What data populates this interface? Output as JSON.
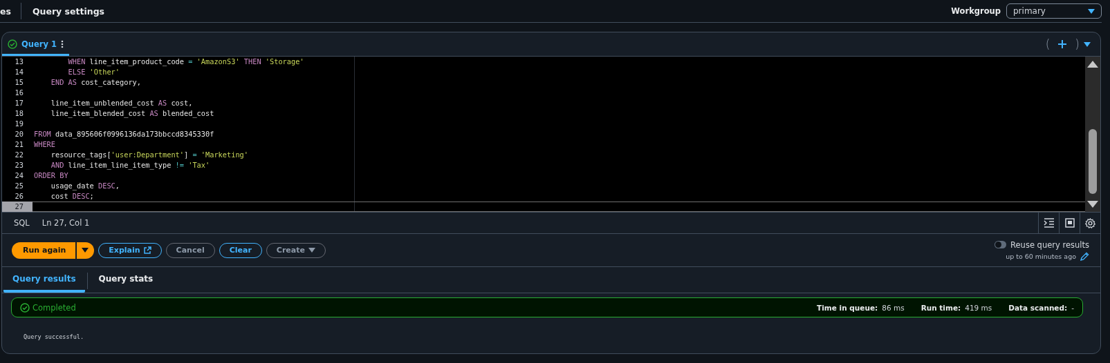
{
  "top_bar": {
    "tabs": [
      {
        "label": "es",
        "selected": false
      },
      {
        "label": "Query settings",
        "selected": false
      }
    ],
    "workgroup": {
      "label": "Workgroup",
      "value": "primary"
    }
  },
  "editor": {
    "tabs": [
      {
        "label": "Query 1",
        "selected": true,
        "succeeded": true
      }
    ],
    "new_tab": {
      "open": "(",
      "close": ")"
    },
    "lines": [
      {
        "number": "13",
        "selected": false,
        "tokens": [
          {
            "text": "        WHEN",
            "kind": "keyword"
          },
          {
            "text": " line_item_product_code ",
            "kind": "plain"
          },
          {
            "text": "=",
            "kind": "operator"
          },
          {
            "text": " 'AmazonS3'",
            "kind": "string"
          },
          {
            "text": " THEN",
            "kind": "keyword"
          },
          {
            "text": " 'Storage'",
            "kind": "string"
          }
        ]
      },
      {
        "number": "14",
        "selected": false,
        "tokens": [
          {
            "text": "        ELSE",
            "kind": "keyword"
          },
          {
            "text": " 'Other'",
            "kind": "string"
          }
        ]
      },
      {
        "number": "15",
        "selected": false,
        "tokens": [
          {
            "text": "    END",
            "kind": "keyword"
          },
          {
            "text": " AS",
            "kind": "keyword"
          },
          {
            "text": " cost_category,",
            "kind": "plain"
          }
        ]
      },
      {
        "number": "16",
        "selected": false
      },
      {
        "number": "17",
        "selected": false,
        "tokens": [
          {
            "text": "    line_item_unblended_cost ",
            "kind": "plain"
          },
          {
            "text": "AS",
            "kind": "keyword"
          },
          {
            "text": " cost,",
            "kind": "plain"
          }
        ]
      },
      {
        "number": "18",
        "selected": false,
        "tokens": [
          {
            "text": "    line_item_blended_cost ",
            "kind": "plain"
          },
          {
            "text": "AS",
            "kind": "keyword"
          },
          {
            "text": " blended_cost",
            "kind": "plain"
          }
        ]
      },
      {
        "number": "19",
        "selected": false
      },
      {
        "number": "20",
        "selected": false,
        "tokens": [
          {
            "text": "FROM",
            "kind": "keyword"
          },
          {
            "text": " data_895606f0996136da173bbccd8345330f",
            "kind": "plain"
          }
        ]
      },
      {
        "number": "21",
        "selected": false,
        "tokens": [
          {
            "text": "WHERE",
            "kind": "keyword"
          }
        ]
      },
      {
        "number": "22",
        "selected": false,
        "tokens": [
          {
            "text": "    resource_tags[",
            "kind": "plain"
          },
          {
            "text": "'user:Department'",
            "kind": "string"
          },
          {
            "text": "] ",
            "kind": "plain"
          },
          {
            "text": "=",
            "kind": "operator"
          },
          {
            "text": " 'Marketing'",
            "kind": "string"
          }
        ]
      },
      {
        "number": "23",
        "selected": false,
        "tokens": [
          {
            "text": "    AND",
            "kind": "keyword"
          },
          {
            "text": " line_item_line_item_type ",
            "kind": "plain"
          },
          {
            "text": "!=",
            "kind": "operator"
          },
          {
            "text": " 'Tax'",
            "kind": "string"
          }
        ]
      },
      {
        "number": "24",
        "selected": false,
        "tokens": [
          {
            "text": "ORDER BY",
            "kind": "keyword"
          }
        ]
      },
      {
        "number": "25",
        "selected": false,
        "tokens": [
          {
            "text": "    usage_date ",
            "kind": "plain"
          },
          {
            "text": "DESC",
            "kind": "keyword"
          },
          {
            "text": ",",
            "kind": "plain"
          }
        ]
      },
      {
        "number": "26",
        "selected": false,
        "tokens": [
          {
            "text": "    cost ",
            "kind": "plain"
          },
          {
            "text": "DESC",
            "kind": "keyword"
          },
          {
            "text": ";",
            "kind": "plain"
          }
        ]
      },
      {
        "number": "27",
        "selected": true
      }
    ],
    "status_bar": {
      "language": "SQL",
      "position": "Ln 27, Col 1"
    }
  },
  "actions": {
    "buttons": [
      {
        "label": "Run again",
        "kind": "primary",
        "disabled": false,
        "split": true
      },
      {
        "label": "Explain",
        "kind": "normal",
        "disabled": false,
        "external": true
      },
      {
        "label": "Cancel",
        "kind": "normal",
        "disabled": true
      },
      {
        "label": "Clear",
        "kind": "normal",
        "disabled": false
      },
      {
        "label": "Create",
        "kind": "normal",
        "disabled": true,
        "dropdown": true
      }
    ],
    "reuse": {
      "label": "Reuse query results",
      "on": false,
      "detail": "up to 60 minutes ago"
    }
  },
  "results": {
    "tabs": [
      {
        "label": "Query results",
        "selected": true
      },
      {
        "label": "Query stats",
        "selected": false
      }
    ],
    "status": {
      "label": "Completed",
      "kind": "success"
    },
    "stats": [
      {
        "label": "Time in queue:",
        "value": "86 ms"
      },
      {
        "label": "Run time:",
        "value": "419 ms"
      },
      {
        "label": "Data scanned:",
        "value": "-"
      }
    ],
    "message": "Query successful."
  }
}
